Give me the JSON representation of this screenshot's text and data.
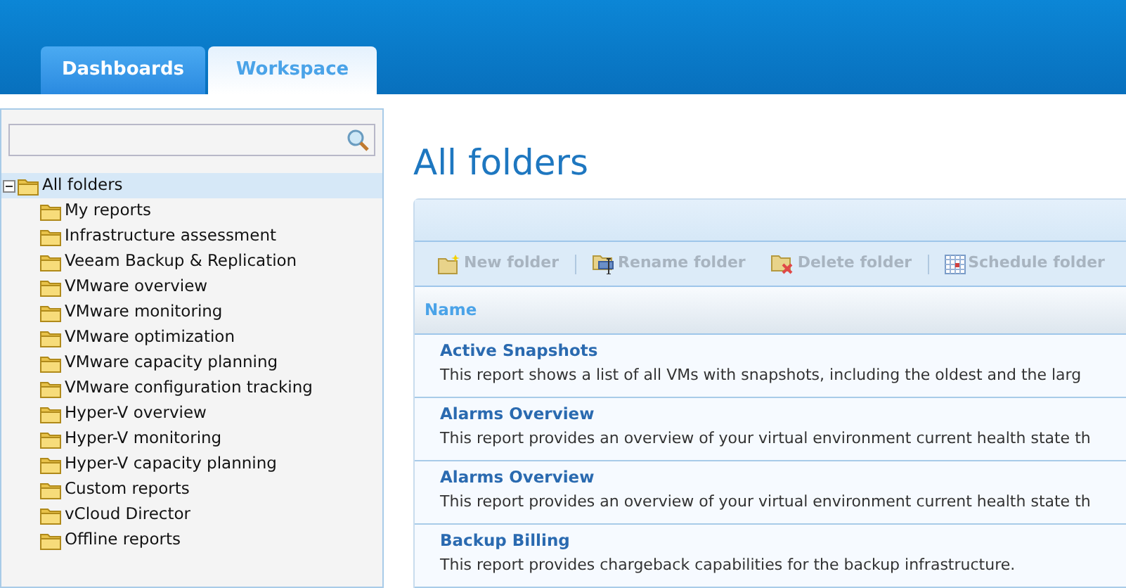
{
  "tabs": [
    {
      "label": "Dashboards",
      "selected": false
    },
    {
      "label": "Workspace",
      "selected": true
    }
  ],
  "sidebar": {
    "tree": [
      {
        "label": "All folders",
        "selected": true,
        "expanded": true,
        "children": [
          {
            "label": "My reports",
            "selected": false
          },
          {
            "label": "Infrastructure assessment",
            "selected": false
          },
          {
            "label": "Veeam Backup & Replication",
            "selected": false
          },
          {
            "label": "VMware overview",
            "selected": false
          },
          {
            "label": "VMware monitoring",
            "selected": false
          },
          {
            "label": "VMware optimization",
            "selected": false
          },
          {
            "label": "VMware capacity planning",
            "selected": false
          },
          {
            "label": "VMware configuration tracking",
            "selected": false
          },
          {
            "label": "Hyper-V overview",
            "selected": false
          },
          {
            "label": "Hyper-V monitoring",
            "selected": false
          },
          {
            "label": "Hyper-V capacity planning",
            "selected": false
          },
          {
            "label": "Custom reports",
            "selected": false
          },
          {
            "label": "vCloud Director",
            "selected": false
          },
          {
            "label": "Offline reports",
            "selected": false
          }
        ]
      }
    ]
  },
  "main": {
    "title": "All folders",
    "toolbar": [
      {
        "label": "New folder",
        "kind": "new",
        "disabled": true,
        "separator_after": true
      },
      {
        "label": "Rename folder",
        "kind": "rename",
        "disabled": true,
        "separator_after": false
      },
      {
        "label": "Delete folder",
        "kind": "delete",
        "disabled": true,
        "separator_after": true
      },
      {
        "label": "Schedule folder",
        "kind": "schedule",
        "disabled": true,
        "separator_after": false
      }
    ],
    "table": {
      "columns": [
        "Name"
      ],
      "rows": [
        {
          "name": "Active Snapshots",
          "description": "This report shows a list of all VMs with snapshots, including the oldest and the larg"
        },
        {
          "name": "Alarms Overview",
          "description": "This report provides an overview of your virtual environment current health state th"
        },
        {
          "name": "Alarms Overview",
          "description": "This report provides an overview of your virtual environment current health state th"
        },
        {
          "name": "Backup Billing",
          "description": "This report provides chargeback capabilities for the backup infrastructure."
        }
      ]
    }
  }
}
